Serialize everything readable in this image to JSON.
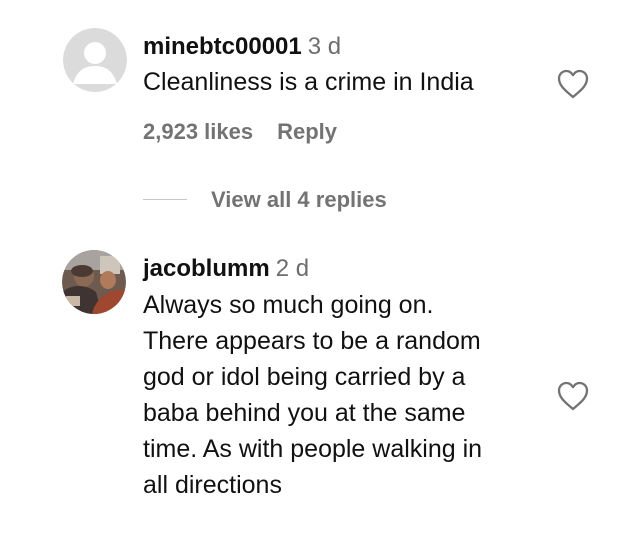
{
  "comments": [
    {
      "username": "minebtc00001",
      "time": "3 d",
      "text_lines": [
        "Cleanliness is a crime in India"
      ],
      "likes": "2,923 likes",
      "reply_label": "Reply",
      "view_replies": "View all 4 replies",
      "avatar": "default-avatar-icon"
    },
    {
      "username": "jacoblumm",
      "time": "2 d",
      "text_lines": [
        "Always so much going on.",
        "There appears to be a random",
        "god or idol being carried by a",
        "baba behind you at the same",
        "time. As with people walking in",
        "all directions"
      ],
      "avatar": "profile-photo"
    }
  ],
  "icons": {
    "like": "heart-outline-icon"
  },
  "colors": {
    "text": "#111111",
    "secondary": "#737373",
    "timestamp": "#6e6e6e",
    "avatar_bg": "#dbdbdb",
    "avatar_fg": "#ffffff"
  }
}
